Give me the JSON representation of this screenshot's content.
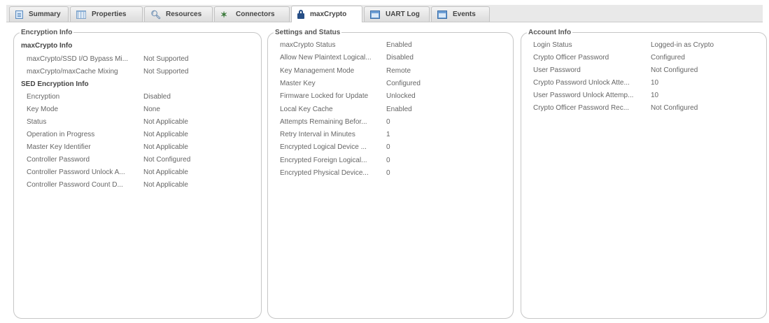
{
  "tabs": [
    {
      "label": "Summary",
      "icon": "summary-doc-icon",
      "active": false
    },
    {
      "label": "Properties",
      "icon": "properties-grid-icon",
      "active": false
    },
    {
      "label": "Resources",
      "icon": "magnifier-icon",
      "active": false
    },
    {
      "label": "Connectors",
      "icon": "connector-icon",
      "active": false
    },
    {
      "label": "maxCrypto",
      "icon": "lock-icon",
      "active": true
    },
    {
      "label": "UART Log",
      "icon": "window-icon",
      "active": false
    },
    {
      "label": "Events",
      "icon": "window-icon",
      "active": false
    }
  ],
  "encryption": {
    "title": "Encryption Info",
    "maxcrypto_header": "maxCrypto Info",
    "maxcrypto_rows": [
      {
        "label": "maxCrypto/SSD I/O Bypass Mi...",
        "value": "Not Supported"
      },
      {
        "label": "maxCrypto/maxCache Mixing",
        "value": "Not Supported"
      }
    ],
    "sed_header": "SED Encryption Info",
    "sed_rows": [
      {
        "label": "Encryption",
        "value": "Disabled"
      },
      {
        "label": "Key Mode",
        "value": "None"
      },
      {
        "label": "Status",
        "value": "Not Applicable"
      },
      {
        "label": "Operation in Progress",
        "value": "Not Applicable"
      },
      {
        "label": "Master Key Identifier",
        "value": "Not Applicable"
      },
      {
        "label": "Controller Password",
        "value": "Not Configured"
      },
      {
        "label": "Controller Password Unlock A...",
        "value": "Not Applicable"
      },
      {
        "label": "Controller Password Count D...",
        "value": "Not Applicable"
      }
    ]
  },
  "settings": {
    "title": "Settings and Status",
    "rows": [
      {
        "label": "maxCrypto Status",
        "value": "Enabled"
      },
      {
        "label": "Allow New Plaintext Logical...",
        "value": "Disabled"
      },
      {
        "label": "Key Management Mode",
        "value": "Remote"
      },
      {
        "label": "Master Key",
        "value": "Configured"
      },
      {
        "label": "Firmware Locked for Update",
        "value": "Unlocked"
      },
      {
        "label": "Local Key Cache",
        "value": "Enabled"
      },
      {
        "label": "Attempts Remaining Befor...",
        "value": "0"
      },
      {
        "label": "Retry Interval in Minutes",
        "value": "1"
      },
      {
        "label": "Encrypted Logical Device ...",
        "value": "0"
      },
      {
        "label": "Encrypted Foreign Logical...",
        "value": "0"
      },
      {
        "label": "Encrypted Physical Device...",
        "value": "0"
      }
    ]
  },
  "account": {
    "title": "Account Info",
    "rows": [
      {
        "label": "Login Status",
        "value": "Logged-in as Crypto"
      },
      {
        "label": "Crypto Officer Password",
        "value": "Configured"
      },
      {
        "label": "User Password",
        "value": "Not Configured"
      },
      {
        "label": "Crypto Password Unlock Atte...",
        "value": "10"
      },
      {
        "label": "User Password Unlock Attemp...",
        "value": "10"
      },
      {
        "label": "Crypto Officer Password Rec...",
        "value": "Not Configured"
      }
    ]
  }
}
